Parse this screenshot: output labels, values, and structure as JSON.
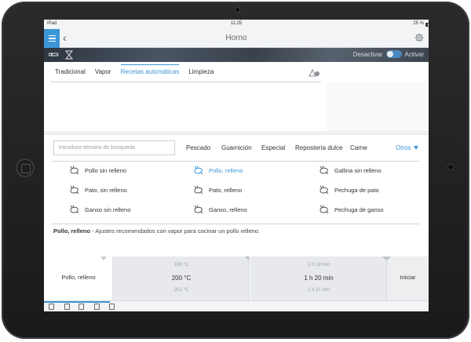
{
  "status_bar": {
    "carrier": "iPad",
    "time": "11:25",
    "battery": "25 %"
  },
  "nav": {
    "title": "Horno",
    "back": "‹"
  },
  "banner": {
    "toggle_off": "Desactivar",
    "toggle_on": "Activar"
  },
  "tabs": [
    "Tradicional",
    "Vapor",
    "Recetas automáticas",
    "Limpieza"
  ],
  "search": {
    "placeholder": "Introduce término de búsqueda"
  },
  "categories": [
    "Pescado",
    "Guarnición",
    "Especial",
    "Repostería dulce",
    "Carne"
  ],
  "otros": "Otros",
  "recipes": [
    [
      "Pollo sin relleno",
      "Pollo, relleno",
      "Gallina sin relleno"
    ],
    [
      "Pato, sin relleno",
      "Pato, relleno",
      "Pechuga de pato"
    ],
    [
      "Ganso sin relleno",
      "Ganso, relleno",
      "Pechuga de ganso"
    ]
  ],
  "selected_recipe": "Pollo, relleno",
  "description": {
    "title": "Pollo, relleno",
    "text": " - Ajustes recomendados con vapor para cocinar un pollo relleno."
  },
  "picker": {
    "name": "Pollo, relleno",
    "temp_prev": "199 °C",
    "temp": "200 °C",
    "temp_next": "201 °C",
    "time_prev": "1 h 19 min",
    "time": "1 h 20 min",
    "time_next": "1 h 21 min",
    "start": "Iniciar"
  },
  "colors": {
    "accent": "#3b96d6",
    "toggle": "#4a89bd"
  },
  "icons": {
    "menu": "menu-icon",
    "back": "back-icon",
    "settings": "gear-icon",
    "recipe": "chicken-icon",
    "alert": "alert-icon",
    "caret": "caret-down-icon"
  }
}
